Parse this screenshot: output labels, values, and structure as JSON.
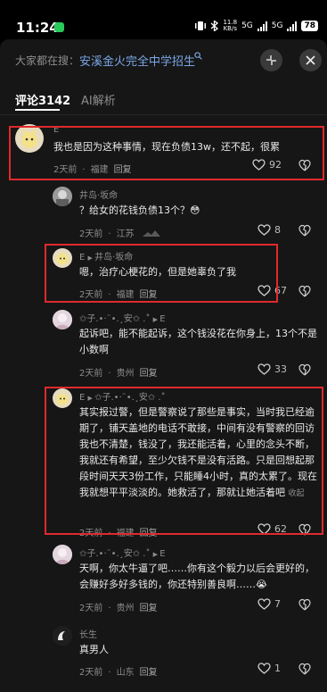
{
  "status": {
    "time": "11:24",
    "speed_top": "11.8",
    "speed_bottom": "KB/s",
    "net1": "5G",
    "net2": "5G",
    "battery": "78"
  },
  "search": {
    "prefix": "大家都在搜：",
    "term": "安溪金火完全中学招生"
  },
  "tabs": {
    "comments": "评论3142",
    "ai": "AI解析"
  },
  "comments": [
    {
      "author": "E",
      "text": "我也是因为这种事情，现在负债13w，还不起，很累",
      "time": "2天前",
      "location": "福建",
      "reply": "回复",
      "likes": "92"
    },
    {
      "author": "井岛·坂命",
      "text": "？给女的花钱负债13个？😳",
      "time": "2天前",
      "location": "江苏",
      "likes": "8"
    },
    {
      "author": "E",
      "reply_to": "井岛·坂命",
      "text": "嗯，治疗心梗花的，但是她辜负了我",
      "time": "2天前",
      "location": "福建",
      "reply": "回复",
      "likes": "67"
    },
    {
      "author": "✩子.•·¨•.¸安✩ .˚",
      "reply_to": "E",
      "text": "起诉吧，能不能起诉，这个钱没花在你身上，13个不是小数啊",
      "time": "2天前",
      "location": "贵州",
      "reply": "回复",
      "likes": "33"
    },
    {
      "author": "E",
      "reply_to": "✩子.•·¨•.¸安✩ .˚",
      "text": "其实报过警，但是警察说了那些是事实，当时我已经逾期了，铺天盖地的电话不敢接，中间有没有警察的回访我也不清楚，钱没了，我还能活着，心里的念头不断，我就还有希望，至少欠钱不是没有活路。只是回想起那段时间天天3份工作，只能睡4小时，真的太累了。现在我就想平平淡淡的。她救活了，那就让她活着吧",
      "fold": "收起",
      "time": "2天前",
      "location": "福建",
      "reply": "回复",
      "likes": "62"
    },
    {
      "author": "✩子.•·¨•.¸安✩ .˚",
      "reply_to": "E",
      "text": "天啊，你太牛逼了吧……你有这个毅力以后会更好的，会赚好多好多钱的，你还特别善良啊……😭",
      "time": "2天前",
      "location": "贵州",
      "reply": "回复",
      "likes": "7"
    },
    {
      "author": "长生",
      "text": "真男人",
      "time": "2天前",
      "location": "山东",
      "reply": "回复",
      "likes": "1"
    }
  ],
  "colors": {
    "highlight": "#e0292d",
    "link": "#7aa7e6",
    "panel": "#161616"
  }
}
